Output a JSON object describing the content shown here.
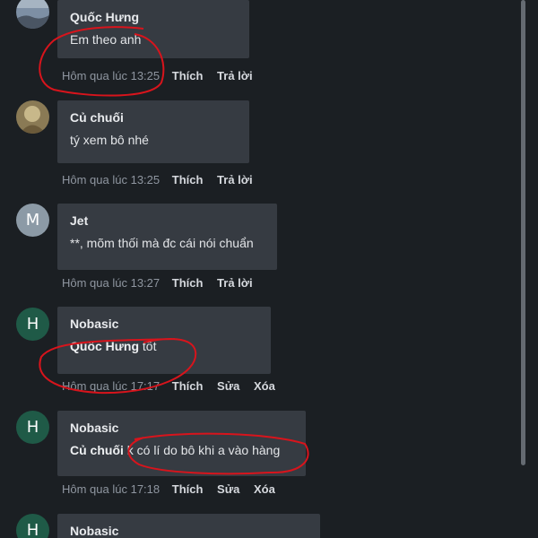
{
  "comments": [
    {
      "author": "Quốc Hưng",
      "text": "Em theo anh",
      "time": "Hôm qua lúc 13:25",
      "actions": [
        "Thích",
        "Trả lời"
      ],
      "avatar": "landscape-photo-avatar"
    },
    {
      "author": "Củ chuối",
      "text": "tý xem bô nhé",
      "time": "Hôm qua lúc 13:25",
      "actions": [
        "Thích",
        "Trả lời"
      ],
      "avatar": "photo-avatar"
    },
    {
      "author": "Jet",
      "text": "**, mõm thối mà đc cái nói chuẩn",
      "time": "Hôm qua lúc 13:27",
      "actions": [
        "Thích",
        "Trả lời"
      ],
      "avatar_letter": "M"
    },
    {
      "author": "Nobasic",
      "mention": "Quốc Hưng",
      "text": " tốt",
      "time": "Hôm qua lúc 17:17",
      "actions": [
        "Thích",
        "Sửa",
        "Xóa"
      ],
      "avatar_letter": "H"
    },
    {
      "author": "Nobasic",
      "mention": "Củ chuối",
      "text": " k có lí do bô khi a vào hàng",
      "time": "Hôm qua lúc 17:18",
      "actions": [
        "Thích",
        "Sửa",
        "Xóa"
      ],
      "avatar_letter": "H"
    },
    {
      "author": "Nobasic",
      "avatar_letter": "H"
    }
  ],
  "colors": {
    "background": "#1b1f23",
    "bubble": "#363b42",
    "annotation": "#d8141c",
    "avatar_h": "#1f5a47",
    "avatar_m": "#8c9aa6"
  }
}
